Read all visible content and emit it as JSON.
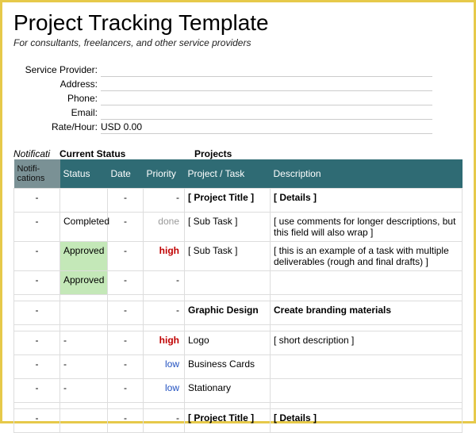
{
  "header": {
    "title": "Project Tracking Template",
    "subtitle": "For consultants, freelancers, and other service providers"
  },
  "info": {
    "labels": {
      "service_provider": "Service Provider:",
      "address": "Address:",
      "phone": "Phone:",
      "email": "Email:",
      "rate_hour": "Rate/Hour:"
    },
    "values": {
      "service_provider": "",
      "address": "",
      "phone": "",
      "email": "",
      "rate_hour": "USD 0.00"
    }
  },
  "section_heads": {
    "notifications": "Notificati",
    "current_status": "Current Status",
    "projects": "Projects"
  },
  "columns": {
    "notifications": "Notifi-\ncations",
    "status": "Status",
    "date": "Date",
    "priority": "Priority",
    "project_task": "Project / Task",
    "description": "Description"
  },
  "rows": [
    {
      "notif": "-",
      "status": "",
      "date": "-",
      "priority": "-",
      "priority_cls": "",
      "task": "[ Project Title ]",
      "task_bold": true,
      "desc": "[ Details ]",
      "desc_bold": true,
      "status_cls": ""
    },
    {
      "notif": "-",
      "status": "Completed",
      "date": "-",
      "priority": "done",
      "priority_cls": "priority-done",
      "task": "[ Sub Task ]",
      "task_bold": false,
      "desc": "[ use comments for longer descriptions, but this field will also wrap ]",
      "desc_bold": false,
      "status_cls": ""
    },
    {
      "notif": "-",
      "status": "Approved",
      "date": "-",
      "priority": "high",
      "priority_cls": "priority-high",
      "task": "[ Sub Task ]",
      "task_bold": false,
      "desc": "[ this is an example of a task with multiple deliverables (rough and final drafts) ]",
      "desc_bold": false,
      "status_cls": "status-approved"
    },
    {
      "notif": "-",
      "status": "Approved",
      "date": "-",
      "priority": "-",
      "priority_cls": "",
      "task": "",
      "task_bold": false,
      "desc": "",
      "desc_bold": false,
      "status_cls": "status-approved"
    },
    {
      "sep": true
    },
    {
      "notif": "-",
      "status": "",
      "date": "-",
      "priority": "-",
      "priority_cls": "",
      "task": "Graphic Design",
      "task_bold": true,
      "desc": "Create branding materials",
      "desc_bold": true,
      "status_cls": ""
    },
    {
      "sep": true
    },
    {
      "notif": "-",
      "status": "-",
      "date": "-",
      "priority": "high",
      "priority_cls": "priority-high",
      "task": "Logo",
      "task_bold": false,
      "desc": "[ short description ]",
      "desc_bold": false,
      "status_cls": ""
    },
    {
      "notif": "-",
      "status": "-",
      "date": "-",
      "priority": "low",
      "priority_cls": "priority-low",
      "task": "Business Cards",
      "task_bold": false,
      "desc": "",
      "desc_bold": false,
      "status_cls": ""
    },
    {
      "notif": "-",
      "status": "-",
      "date": "-",
      "priority": "low",
      "priority_cls": "priority-low",
      "task": "Stationary",
      "task_bold": false,
      "desc": "",
      "desc_bold": false,
      "status_cls": ""
    },
    {
      "sep": true
    },
    {
      "notif": "-",
      "status": "",
      "date": "-",
      "priority": "-",
      "priority_cls": "",
      "task": "[ Project Title ]",
      "task_bold": true,
      "desc": "[ Details ]",
      "desc_bold": true,
      "status_cls": ""
    }
  ]
}
